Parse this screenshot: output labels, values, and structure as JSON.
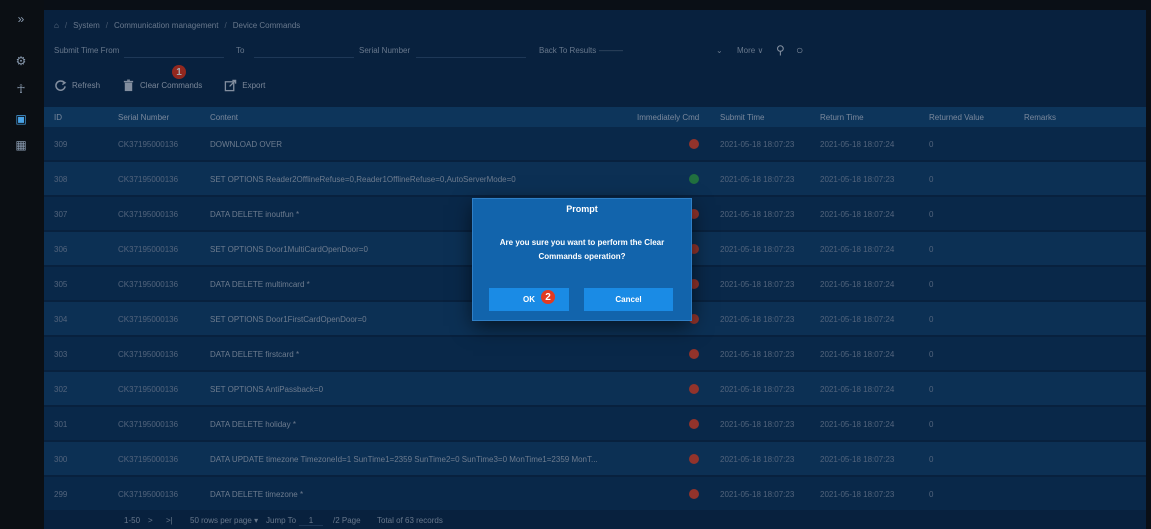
{
  "breadcrumb": {
    "items": [
      "System",
      "Communication management",
      "Device Commands"
    ],
    "separator": "/"
  },
  "filters": {
    "submit_time_from": "Submit Time From",
    "to": "To",
    "serial_number": "Serial Number",
    "back_to_results": "Back To Results",
    "back_to_results_value": "———",
    "more": "More",
    "more_caret": "∨"
  },
  "toolbar": {
    "refresh": "Refresh",
    "clear_commands": "Clear Commands",
    "export": "Export"
  },
  "annotations": {
    "badge1": "1",
    "badge2": "2"
  },
  "table": {
    "columns": [
      "ID",
      "Serial Number",
      "Content",
      "Immediately Cmd",
      "Submit Time",
      "Return Time",
      "Returned Value",
      "Remarks"
    ],
    "rows": [
      {
        "id": "309",
        "serial": "CK37195000136",
        "content": "DOWNLOAD OVER",
        "status": "error",
        "submit": "2021-05-18 18:07:23",
        "return": "2021-05-18 18:07:24",
        "value": "0"
      },
      {
        "id": "308",
        "serial": "CK37195000136",
        "content": "SET OPTIONS Reader2OfflineRefuse=0,Reader1OfflineRefuse=0,AutoServerMode=0",
        "status": "ok",
        "submit": "2021-05-18 18:07:23",
        "return": "2021-05-18 18:07:23",
        "value": "0"
      },
      {
        "id": "307",
        "serial": "CK37195000136",
        "content": "DATA DELETE inoutfun *",
        "status": "error",
        "submit": "2021-05-18 18:07:23",
        "return": "2021-05-18 18:07:24",
        "value": "0"
      },
      {
        "id": "306",
        "serial": "CK37195000136",
        "content": "SET OPTIONS Door1MultiCardOpenDoor=0",
        "status": "error",
        "submit": "2021-05-18 18:07:23",
        "return": "2021-05-18 18:07:24",
        "value": "0"
      },
      {
        "id": "305",
        "serial": "CK37195000136",
        "content": "DATA DELETE multimcard *",
        "status": "error",
        "submit": "2021-05-18 18:07:23",
        "return": "2021-05-18 18:07:24",
        "value": "0"
      },
      {
        "id": "304",
        "serial": "CK37195000136",
        "content": "SET OPTIONS Door1FirstCardOpenDoor=0",
        "status": "error",
        "submit": "2021-05-18 18:07:23",
        "return": "2021-05-18 18:07:24",
        "value": "0"
      },
      {
        "id": "303",
        "serial": "CK37195000136",
        "content": "DATA DELETE firstcard *",
        "status": "error",
        "submit": "2021-05-18 18:07:23",
        "return": "2021-05-18 18:07:24",
        "value": "0"
      },
      {
        "id": "302",
        "serial": "CK37195000136",
        "content": "SET OPTIONS AntiPassback=0",
        "status": "error",
        "submit": "2021-05-18 18:07:23",
        "return": "2021-05-18 18:07:24",
        "value": "0"
      },
      {
        "id": "301",
        "serial": "CK37195000136",
        "content": "DATA DELETE holiday *",
        "status": "error",
        "submit": "2021-05-18 18:07:23",
        "return": "2021-05-18 18:07:24",
        "value": "0"
      },
      {
        "id": "300",
        "serial": "CK37195000136",
        "content": "DATA UPDATE timezone TimezoneId=1 SunTime1=2359 SunTime2=0 SunTime3=0 MonTime1=2359 MonT...",
        "status": "error",
        "submit": "2021-05-18 18:07:23",
        "return": "2021-05-18 18:07:23",
        "value": "0"
      },
      {
        "id": "299",
        "serial": "CK37195000136",
        "content": "DATA DELETE timezone *",
        "status": "error",
        "submit": "2021-05-18 18:07:23",
        "return": "2021-05-18 18:07:23",
        "value": "0"
      }
    ]
  },
  "pager": {
    "range": "1-50",
    "next": ">",
    "last": ">|",
    "rows_per_page": "50 rows per page",
    "caret": "▾",
    "jump_to": "Jump To",
    "page_input": "1",
    "page_total": "/2 Page",
    "total": "Total of 63 records"
  },
  "dialog": {
    "title": "Prompt",
    "message": "Are you sure you want to perform the Clear Commands operation?",
    "ok": "OK",
    "cancel": "Cancel"
  },
  "colors": {
    "panel": "#0d2f52",
    "header": "#154d7e",
    "dialog": "#1264ac",
    "button": "#1a8be5",
    "badge": "#e23a22",
    "error": "#e04a35",
    "ok": "#33a853"
  }
}
